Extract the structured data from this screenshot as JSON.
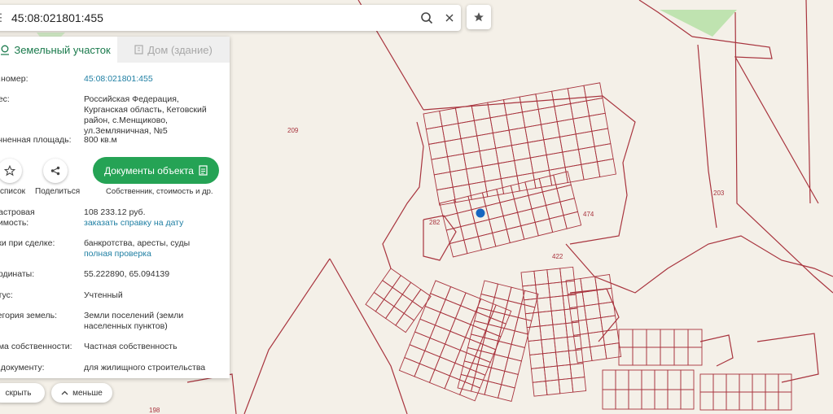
{
  "search": {
    "value": "45:08:021801:455"
  },
  "tabs": [
    {
      "label": "Земельный участок",
      "icon": "location-icon"
    },
    {
      "label": "Дом (здание)",
      "icon": "building-icon"
    }
  ],
  "info": {
    "cadnum_label": "д.номер:",
    "cadnum_value": "45:08:021801:455",
    "address_label": "рес:",
    "address_value": "Российская Федерация, Курганская область, Кетовский район, с.Менщиково, ул.Земляничная, №5",
    "area_label": "очненная площадь:",
    "area_value": "800 кв.м",
    "cad_cost_label1": "дастровая",
    "cad_cost_label2": "оимость:",
    "cad_cost_value": "108 233.12 руб.",
    "cad_cost_link": "заказать справку на дату",
    "risks_label": "ски при сделке:",
    "risks_value": "банкротства, аресты, суды",
    "risks_link": "полная проверка",
    "coords_label": "ординаты:",
    "coords_value": "55.222890, 65.094139",
    "status_label": "атус:",
    "status_value": "Учтенный",
    "category_label": "тегория земель:",
    "category_value": "Земли поселений (земли населенных пунктов)",
    "ownership_label": "рма собственности:",
    "ownership_value": "Частная собственность",
    "usage_label": "о документу:",
    "usage_value": "для жилищного строительства"
  },
  "actions": {
    "to_list_label": "список",
    "share_label": "Поделиться",
    "docs_label": "Документы объекта",
    "docs_sub": "Собственник, стоимость и др."
  },
  "bottom": {
    "hide_label": "скрыть",
    "less_label": "меньше"
  },
  "map_labels": {
    "area_209": "209",
    "area_203": "203",
    "area_198": "198",
    "plot_282": "282",
    "plot_422": "422",
    "plot_474": "474"
  },
  "colors": {
    "accent": "#25a355",
    "link": "#1f7fa3",
    "map_bg": "#f4f0e8",
    "boundary": "#a8343e",
    "marker": "#1565c0"
  }
}
